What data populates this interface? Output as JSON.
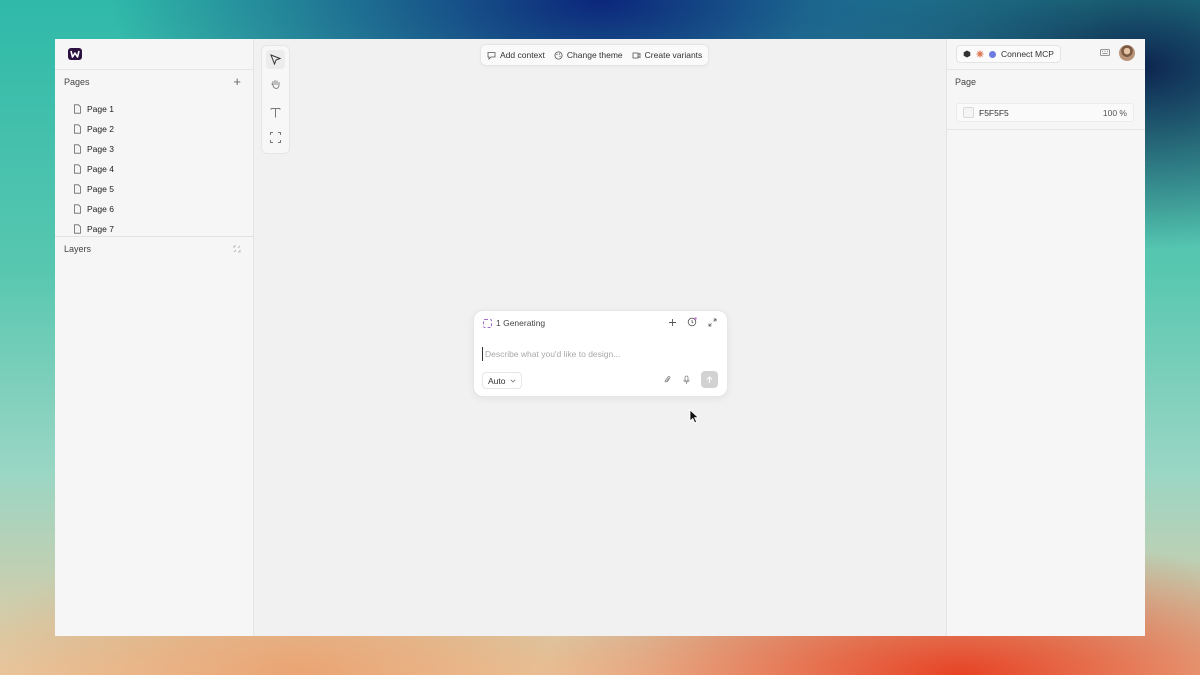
{
  "left_panel": {
    "pages_title": "Pages",
    "add_page": "+",
    "pages": [
      {
        "label": "Page 1"
      },
      {
        "label": "Page 2"
      },
      {
        "label": "Page 3"
      },
      {
        "label": "Page 4"
      },
      {
        "label": "Page 5"
      },
      {
        "label": "Page 6"
      },
      {
        "label": "Page 7"
      }
    ],
    "layers_title": "Layers"
  },
  "tools": [
    {
      "name": "select-tool-icon",
      "active": true
    },
    {
      "name": "hand-tool-icon",
      "active": false
    },
    {
      "name": "text-tool-icon",
      "active": false
    },
    {
      "name": "frame-tool-icon",
      "active": false
    }
  ],
  "top_toolbar": {
    "add_context": "Add context",
    "change_theme": "Change theme",
    "create_variants": "Create variants"
  },
  "right_panel": {
    "connect_mcp": "Connect MCP",
    "page_label": "Page",
    "color_value": "F5F5F5",
    "opacity": "100 %"
  },
  "prompt": {
    "status": "1 Generating",
    "placeholder": "Describe what you'd like to design...",
    "model": "Auto"
  },
  "colors": {
    "accent_purple": "#a06ac9",
    "background_swatch": "#F5F5F5"
  }
}
